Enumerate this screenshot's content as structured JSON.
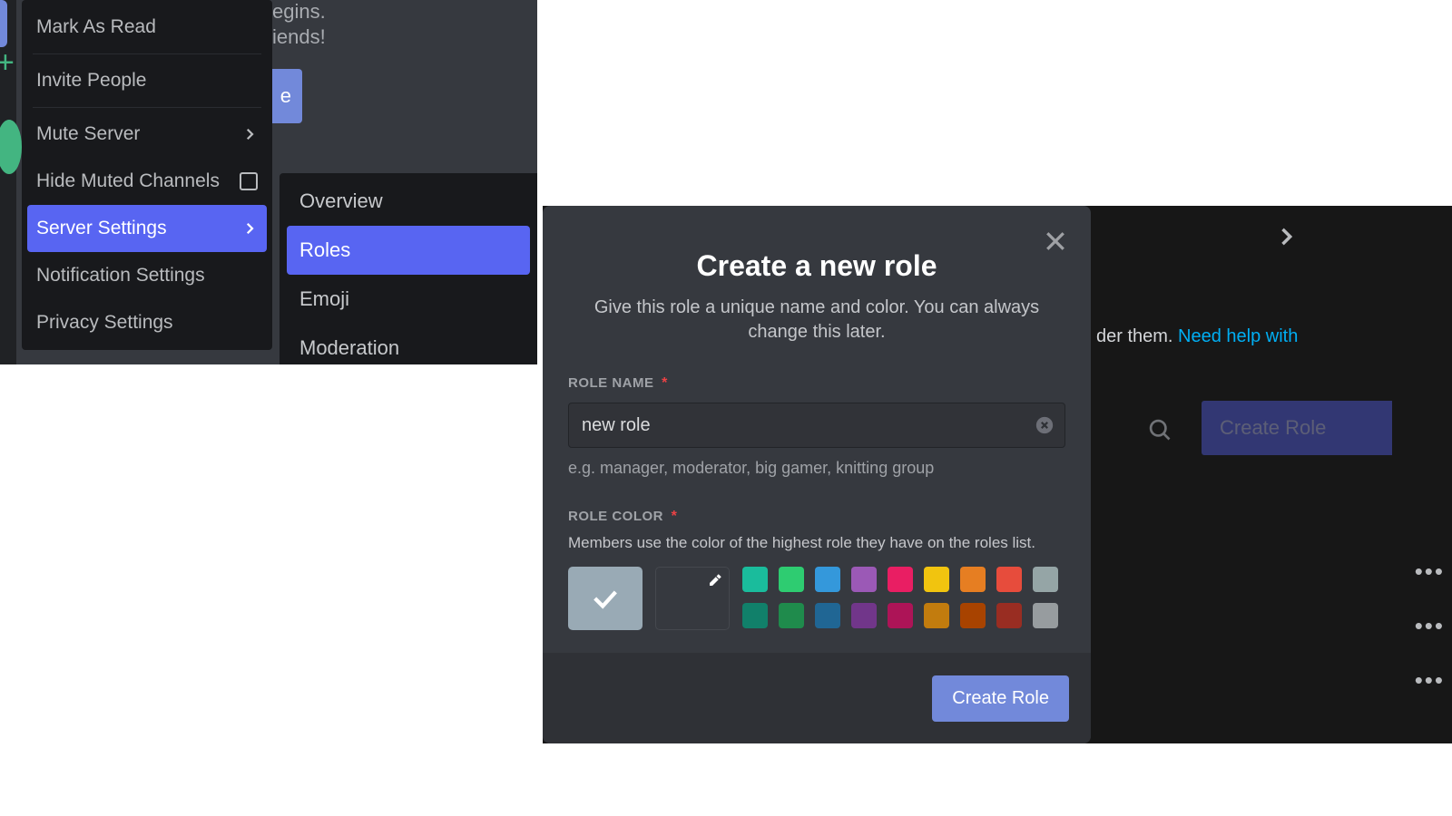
{
  "context_menu": {
    "items": [
      {
        "label": "Mark As Read",
        "kind": "plain"
      },
      {
        "label": "Invite People",
        "kind": "plain"
      },
      {
        "label": "Mute Server",
        "kind": "chevron"
      },
      {
        "label": "Hide Muted Channels",
        "kind": "checkbox"
      },
      {
        "label": "Server Settings",
        "kind": "chevron",
        "active": true
      },
      {
        "label": "Notification Settings",
        "kind": "plain"
      },
      {
        "label": "Privacy Settings",
        "kind": "plain"
      }
    ],
    "submenu": [
      {
        "label": "Overview"
      },
      {
        "label": "Roles",
        "active": true
      },
      {
        "label": "Emoji"
      },
      {
        "label": "Moderation"
      }
    ],
    "bg_line1": "egins.",
    "bg_line2": "iends!",
    "bg_btn_frag": "e"
  },
  "behind": {
    "help_prefix": "der them. ",
    "help_link": "Need help with",
    "create_role_btn": "Create Role"
  },
  "modal": {
    "title": "Create a new role",
    "subtitle": "Give this role a unique name and color. You can always change this later.",
    "role_name_label": "Role Name",
    "role_name_value": "new role",
    "role_name_hint": "e.g. manager, moderator, big gamer, knitting group",
    "role_color_label": "Role Color",
    "role_color_desc": "Members use the color of the highest role they have on the roles list.",
    "create_btn": "Create Role",
    "required_mark": "*",
    "default_color": "#99aab5",
    "colors_row1": [
      "#1abc9c",
      "#2ecc71",
      "#3498db",
      "#9b59b6",
      "#e91e63",
      "#f1c40f",
      "#e67e22",
      "#e74c3c",
      "#95a5a6"
    ],
    "colors_row2": [
      "#11806a",
      "#1f8b4c",
      "#206694",
      "#71368a",
      "#ad1457",
      "#c27c0e",
      "#a84300",
      "#992d22",
      "#979c9f"
    ]
  }
}
